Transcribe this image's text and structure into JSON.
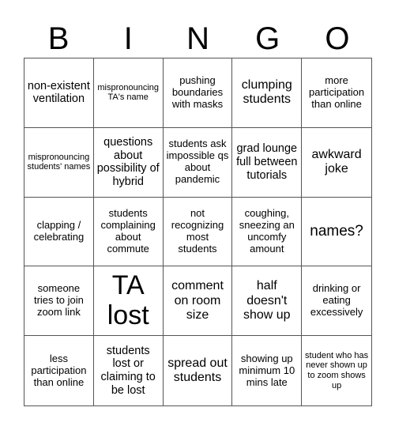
{
  "header": [
    "B",
    "I",
    "N",
    "G",
    "O"
  ],
  "cells": [
    "non-existent ventilation",
    "mispronouncing TA's name",
    "pushing boundaries with masks",
    "clumping students",
    "more participation than online",
    "mispronouncing students' names",
    "questions about possibility of hybrid",
    "students ask impossible qs about pandemic",
    "grad lounge full between tutorials",
    "awkward joke",
    "clapping / celebrating",
    "students complaining about commute",
    "not recognizing most students",
    "coughing, sneezing an uncomfy amount",
    "names?",
    "someone tries to join zoom link",
    "TA lost",
    "comment on room size",
    "half doesn't show up",
    "drinking or eating excessively",
    "less participation than online",
    "students lost or claiming to be lost",
    "spread out students",
    "showing up minimum 10 mins late",
    "student who has never shown up to zoom shows up"
  ]
}
